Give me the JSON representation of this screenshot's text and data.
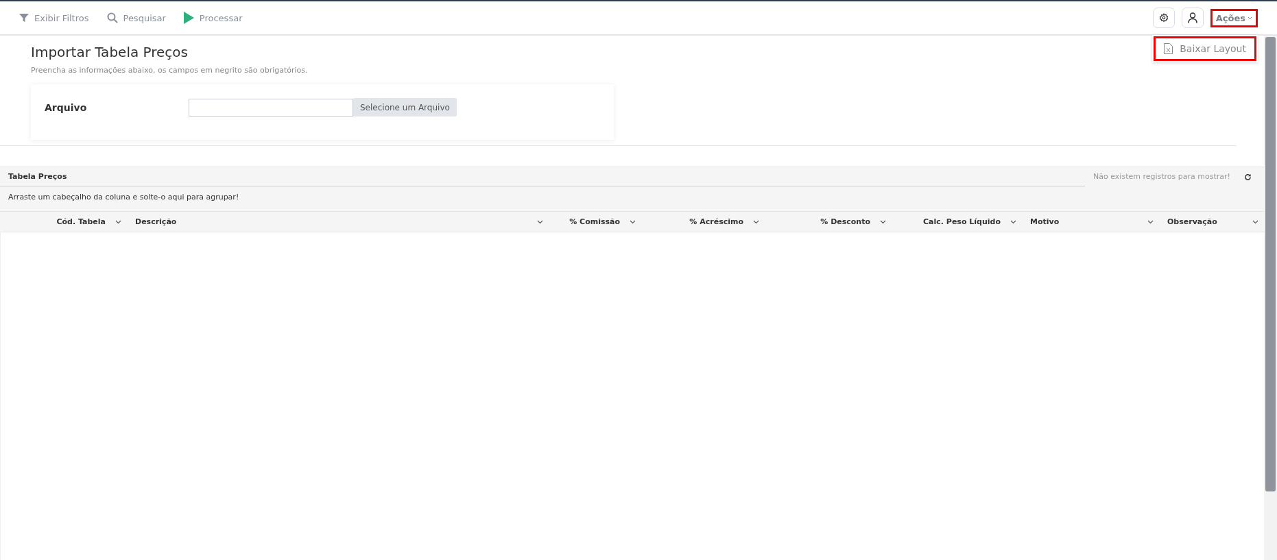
{
  "toolbar": {
    "items": [
      {
        "kind": "filter",
        "label": "Exibir Filtros"
      },
      {
        "kind": "search",
        "label": "Pesquisar"
      },
      {
        "kind": "play",
        "label": "Processar"
      }
    ],
    "actions_menu": {
      "label": "Ações",
      "expanded": true,
      "items": [
        {
          "label": "Baixar Layout"
        }
      ]
    }
  },
  "form": {
    "title": "Importar Tabela Preços",
    "subtitle": "Preencha as informações abaixo, os campos em negrito são obrigatórios.",
    "fields": [
      {
        "label": "Arquivo",
        "required": true,
        "button": "Selecione um Arquivo"
      }
    ]
  },
  "grid": {
    "title": "Tabela Preços",
    "empty_message": "Não existem registros para mostrar!",
    "group_hint": "Arraste um cabeçalho da coluna e solte-o aqui para agrupar!",
    "columns": [
      {
        "label": "Cód. Tabela",
        "kind": "number"
      },
      {
        "label": "Descrição",
        "kind": "text"
      },
      {
        "label": "% Comissão",
        "kind": "number"
      },
      {
        "label": "% Acréscimo",
        "kind": "number"
      },
      {
        "label": "% Desconto",
        "kind": "number"
      },
      {
        "label": "Calc. Peso Líquido",
        "kind": "number"
      },
      {
        "label": "Motivo",
        "kind": "text"
      },
      {
        "label": "Observação",
        "kind": "text"
      }
    ]
  }
}
